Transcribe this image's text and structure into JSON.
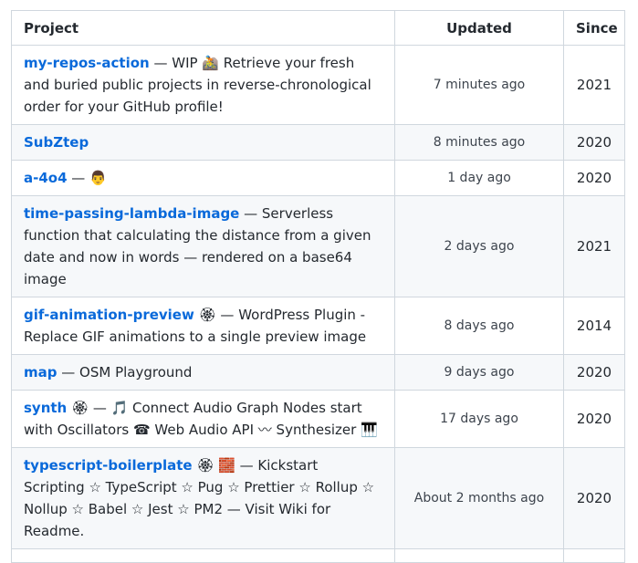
{
  "table": {
    "headers": {
      "project": "Project",
      "updated": "Updated",
      "since": "Since"
    },
    "rows": [
      {
        "name": "my-repos-action",
        "description": " — WIP 🚵 Retrieve your fresh and buried public projects in reverse-chronological order for your GitHub profile!",
        "updated": "7 minutes ago",
        "since": "2021"
      },
      {
        "name": "SubZtep",
        "description": "",
        "updated": "8 minutes ago",
        "since": "2020"
      },
      {
        "name": "a-4o4",
        "description": " — 👨",
        "updated": "1 day ago",
        "since": "2020"
      },
      {
        "name": "time-passing-lambda-image",
        "description": " — Serverless function that calculating the distance from a given date and now in words — rendered on a base64 image",
        "updated": "2 days ago",
        "since": "2021"
      },
      {
        "name": "gif-animation-preview",
        "description": " 🏵 — WordPress Plugin - Replace GIF animations to a single preview image",
        "updated": "8 days ago",
        "since": "2014"
      },
      {
        "name": "map",
        "description": " — OSM Playground",
        "updated": "9 days ago",
        "since": "2020"
      },
      {
        "name": "synth",
        "description": " 🏵 — 🎵 Connect Audio Graph Nodes start with Oscillators ☎ Web Audio API 〰 Synthesizer 🎹",
        "updated": "17 days ago",
        "since": "2020"
      },
      {
        "name": "typescript-boilerplate",
        "description": " 🏵 🧱 — Kickstart Scripting ☆ TypeScript ☆ Pug ☆ Prettier ☆ Rollup ☆ Nollup ☆ Babel ☆ Jest ☆ PM2 — Visit Wiki for Readme.",
        "updated": "About 2 months ago",
        "since": "2020"
      }
    ]
  }
}
